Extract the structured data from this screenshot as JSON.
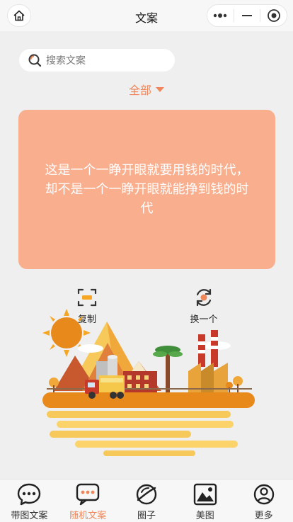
{
  "nav": {
    "title": "文案"
  },
  "search": {
    "placeholder": "搜索文案"
  },
  "filter": {
    "label": "全部"
  },
  "card": {
    "line1": "这是一个一睁开眼就要用钱的时代，",
    "line2": "却不是一个一睁开眼就能挣到钱的时",
    "line3": "代",
    "color": "#f9ae8e"
  },
  "actions": {
    "copy": "复制",
    "next": "换一个"
  },
  "tabs": [
    {
      "label": "带图文案",
      "icon": "chat-bubble-icon"
    },
    {
      "label": "随机文案",
      "icon": "chat-dots-icon",
      "active": true
    },
    {
      "label": "圈子",
      "icon": "planet-icon"
    },
    {
      "label": "美图",
      "icon": "image-icon"
    },
    {
      "label": "更多",
      "icon": "user-circle-icon"
    }
  ],
  "colors": {
    "accent": "#f0875a",
    "background": "#f0eff0"
  }
}
